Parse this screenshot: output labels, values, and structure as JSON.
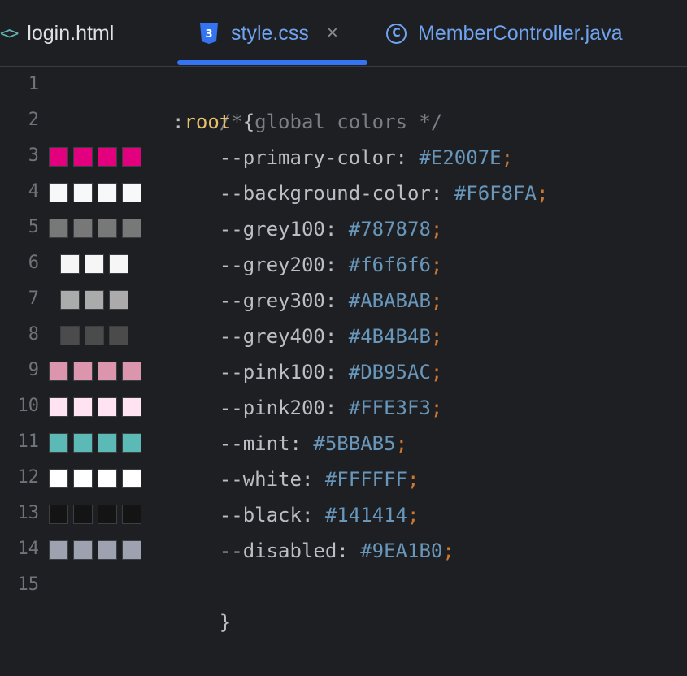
{
  "tabs": [
    {
      "icon": "<>",
      "label": "login.html"
    },
    {
      "icon": "css-file-icon",
      "label": "style.css",
      "close": "×"
    },
    {
      "icon": "C",
      "label": "MemberController.java"
    }
  ],
  "colors": {
    "active_tab_underline": "#3574f0",
    "tab_link": "#6fa3ef",
    "comment": "#7a7e85",
    "selector": "#e8bf6a",
    "value": "#6897bb",
    "semicolon": "#cc7832"
  },
  "code": {
    "comment": "/* global colors */",
    "colon": ":",
    "selector": "root",
    "open_brace": " {",
    "close_brace": "}",
    "indent": "    ",
    "separator": ": ",
    "semicolon": ";",
    "declarations": [
      {
        "line": "3",
        "property": "--primary-color",
        "value": "#E2007E",
        "swatch": "#E2007E"
      },
      {
        "line": "4",
        "property": "--background-color",
        "value": "#F6F8FA",
        "swatch": "#F6F8FA"
      },
      {
        "line": "5",
        "property": "--grey100",
        "value": "#787878",
        "swatch": "#787878"
      },
      {
        "line": "6",
        "property": "--grey200",
        "value": "#f6f6f6",
        "swatch": "#f6f6f6"
      },
      {
        "line": "7",
        "property": "--grey300",
        "value": "#ABABAB",
        "swatch": "#ABABAB"
      },
      {
        "line": "8",
        "property": "--grey400",
        "value": "#4B4B4B",
        "swatch": "#4B4B4B"
      },
      {
        "line": "9",
        "property": "--pink100",
        "value": "#DB95AC",
        "swatch": "#DB95AC"
      },
      {
        "line": "10",
        "property": "--pink200",
        "value": "#FFE3F3",
        "swatch": "#FFE3F3"
      },
      {
        "line": "11",
        "property": "--mint",
        "value": "#5BBAB5",
        "swatch": "#5BBAB5"
      },
      {
        "line": "12",
        "property": "--white",
        "value": "#FFFFFF",
        "swatch": "#FFFFFF"
      },
      {
        "line": "13",
        "property": "--black",
        "value": "#141414",
        "swatch": "#141414"
      },
      {
        "line": "14",
        "property": "--disabled",
        "value": "#9EA1B0",
        "swatch": "#9EA1B0"
      }
    ]
  },
  "line_numbers": [
    "1",
    "2",
    "3",
    "4",
    "5",
    "6",
    "7",
    "8",
    "9",
    "10",
    "11",
    "12",
    "13",
    "14",
    "15"
  ]
}
